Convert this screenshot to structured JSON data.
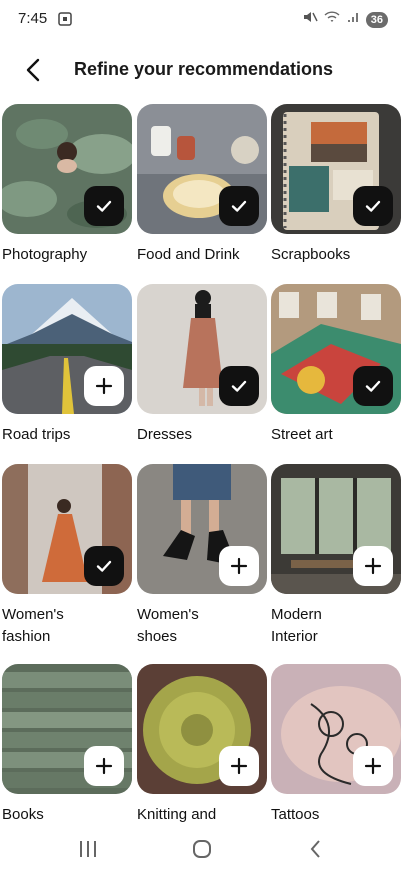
{
  "status_bar": {
    "time": "7:45",
    "battery": "36"
  },
  "header": {
    "title": "Refine your recommendations"
  },
  "topics": [
    {
      "label": "Photography",
      "selected": true
    },
    {
      "label": "Food and Drink",
      "selected": true
    },
    {
      "label": "Scrapbooks",
      "selected": true
    },
    {
      "label": "Road trips",
      "selected": false
    },
    {
      "label": "Dresses",
      "selected": true
    },
    {
      "label": "Street art",
      "selected": true
    },
    {
      "label": "Women's\nfashion",
      "selected": true
    },
    {
      "label": "Women's\nshoes",
      "selected": false
    },
    {
      "label": "Modern\nInterior",
      "selected": false
    },
    {
      "label": "Books",
      "selected": false
    },
    {
      "label": "Knitting and",
      "selected": false
    },
    {
      "label": "Tattoos",
      "selected": false
    }
  ],
  "icons": {
    "selected": "check-icon",
    "unselected": "plus-icon"
  }
}
